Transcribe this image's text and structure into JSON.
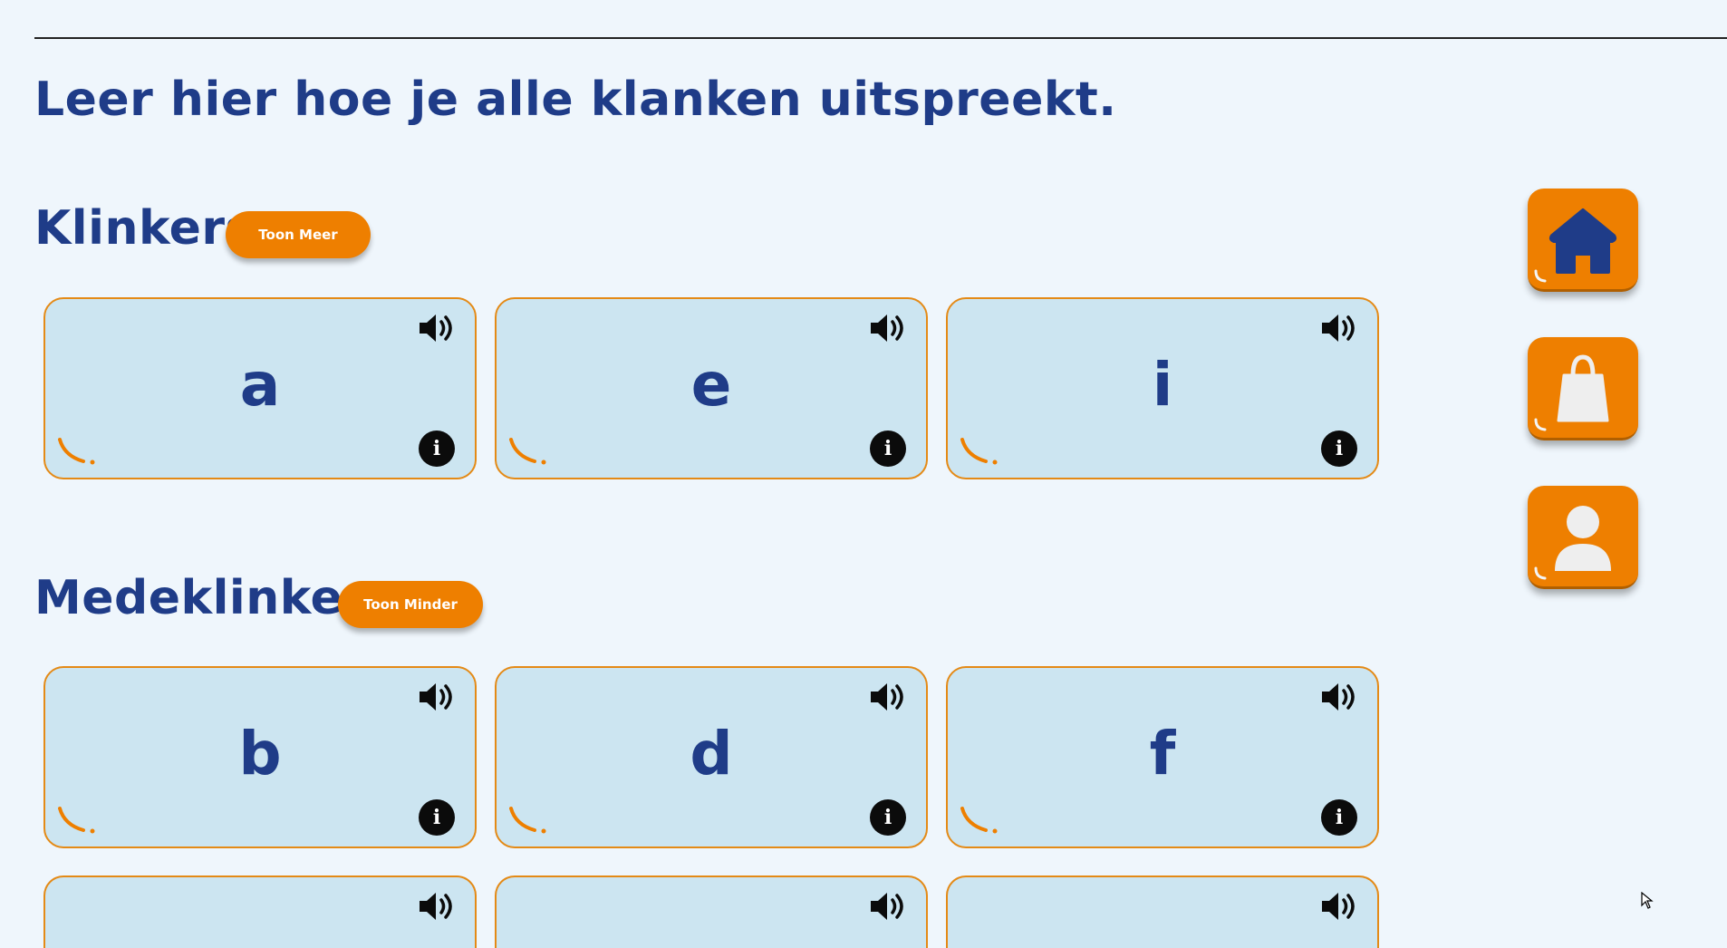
{
  "page": {
    "title": "Leer hier hoe je alle klanken uitspreekt."
  },
  "sections": {
    "klinkers": {
      "title": "Klinkers",
      "toggle_label": "Toon Meer",
      "cards": [
        {
          "letter": "a"
        },
        {
          "letter": "e"
        },
        {
          "letter": "i"
        }
      ]
    },
    "medeklinkers": {
      "title": "Medeklinkers",
      "toggle_label": "Toon Minder",
      "cards": [
        {
          "letter": "b"
        },
        {
          "letter": "d"
        },
        {
          "letter": "f"
        }
      ],
      "partial_cards": [
        {
          "letter": ""
        },
        {
          "letter": ""
        },
        {
          "letter": ""
        }
      ]
    }
  },
  "card_icons": {
    "audio": "speaker-icon",
    "info": "info-icon",
    "info_glyph": "i",
    "corner": "arc-decoration-icon"
  },
  "side_nav": [
    {
      "name": "home",
      "icon": "home-icon"
    },
    {
      "name": "shop",
      "icon": "shopping-bag-icon"
    },
    {
      "name": "profile",
      "icon": "user-icon"
    }
  ],
  "colors": {
    "background": "#eff6fc",
    "card_background": "#cce5f1",
    "card_border": "#e48a16",
    "accent_orange": "#ee7f00",
    "text_navy": "#1f3c88",
    "icon_light": "#eeeeee"
  }
}
